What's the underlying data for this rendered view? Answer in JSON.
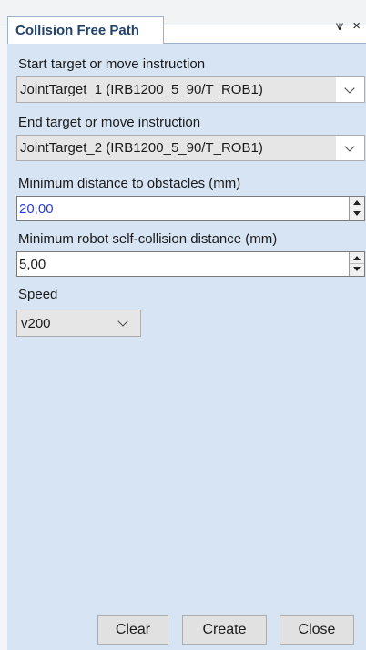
{
  "panel": {
    "tab_title": "Collision Free Path",
    "pin_glyph": "⩛",
    "close_glyph": "×"
  },
  "start": {
    "label": "Start target or move instruction",
    "value": "JointTarget_1 (IRB1200_5_90/T_ROB1)"
  },
  "end": {
    "label": "End target or move instruction",
    "value": "JointTarget_2 (IRB1200_5_90/T_ROB1)"
  },
  "min_obstacle": {
    "label": "Minimum distance to obstacles (mm)",
    "value": "20,00",
    "value_color": "#2b3bd6"
  },
  "min_self": {
    "label": "Minimum robot self-collision distance (mm)",
    "value": "5,00"
  },
  "speed": {
    "label": "Speed",
    "value": "v200"
  },
  "buttons": {
    "clear": "Clear",
    "create": "Create",
    "close": "Close"
  },
  "colors": {
    "panel_bg": "#d6e4f3",
    "tab_text": "#23426b"
  }
}
